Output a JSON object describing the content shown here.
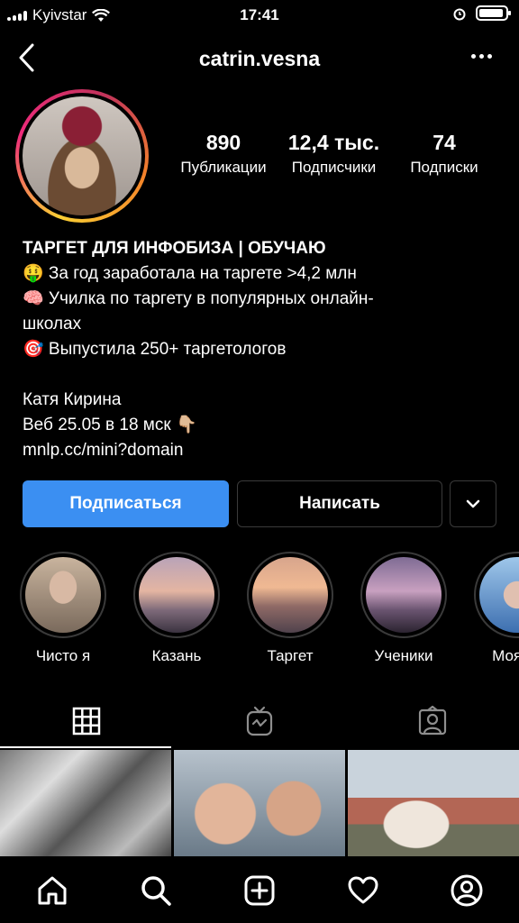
{
  "status_bar": {
    "carrier": "Kyivstar",
    "time": "17:41"
  },
  "header": {
    "username": "catrin.vesna"
  },
  "stats": [
    {
      "value": "890",
      "label": "Публикации"
    },
    {
      "value": "12,4 тыс.",
      "label": "Подписчики"
    },
    {
      "value": "74",
      "label": "Подписки"
    }
  ],
  "bio": {
    "name": "ТАРГЕТ ДЛЯ ИНФОБИЗА  | ОБУЧАЮ",
    "lines": [
      "🤑 За год заработала на таргете >4,2 млн",
      "🧠 Училка по таргету в популярных онлайн-",
      "школах",
      "🎯 Выпустила 250+ таргетологов",
      "",
      "Катя Кирина",
      "Веб 25.05 в 18 мск 👇🏼",
      "mnlp.cc/mini?domain"
    ]
  },
  "buttons": {
    "follow": "Подписаться",
    "message": "Написать"
  },
  "highlights": [
    {
      "label": "Чисто я"
    },
    {
      "label": "Казань"
    },
    {
      "label": "Таргет"
    },
    {
      "label": "Ученики"
    },
    {
      "label": "Моя ис"
    }
  ],
  "tabs": [
    "grid-icon",
    "igtv-icon",
    "tagged-icon"
  ],
  "bottom_nav": [
    "home-icon",
    "search-icon",
    "add-icon",
    "heart-icon",
    "profile-icon"
  ],
  "colors": {
    "accent": "#3b8ff2",
    "background": "#000000"
  }
}
